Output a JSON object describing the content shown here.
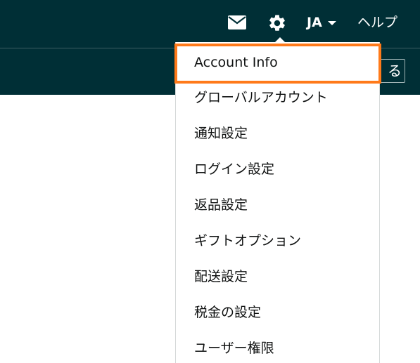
{
  "header": {
    "language_code": "JA",
    "help_label": "ヘルプ",
    "mail_icon": "mail-icon",
    "settings_icon": "gear-icon",
    "accent_color": "#002f36"
  },
  "subbar": {
    "button_fragment": "る"
  },
  "settings_menu": {
    "highlight_color": "#ff7a1a",
    "items": [
      {
        "label": "Account Info"
      },
      {
        "label": "グローバルアカウント"
      },
      {
        "label": "通知設定"
      },
      {
        "label": "ログイン設定"
      },
      {
        "label": "返品設定"
      },
      {
        "label": "ギフトオプション"
      },
      {
        "label": "配送設定"
      },
      {
        "label": "税金の設定"
      },
      {
        "label": "ユーザー権限"
      }
    ]
  }
}
